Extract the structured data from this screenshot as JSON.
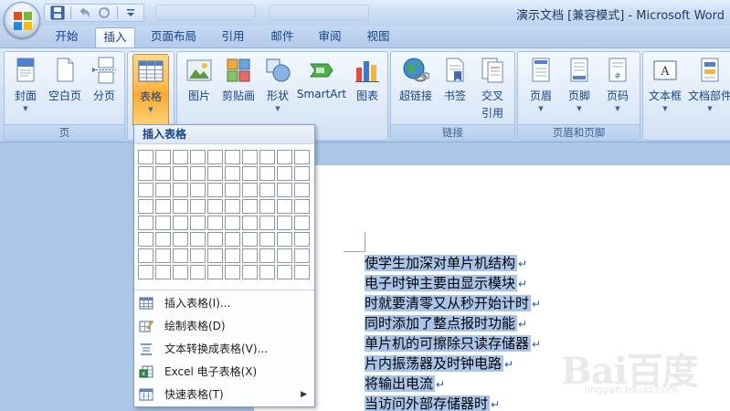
{
  "window": {
    "title": "演示文档 [兼容模式] - Microsoft Word"
  },
  "tabs": [
    {
      "label": "开始",
      "active": false
    },
    {
      "label": "插入",
      "active": true
    },
    {
      "label": "页面布局",
      "active": false
    },
    {
      "label": "引用",
      "active": false
    },
    {
      "label": "邮件",
      "active": false
    },
    {
      "label": "审阅",
      "active": false
    },
    {
      "label": "视图",
      "active": false
    }
  ],
  "ribbon": {
    "groups": {
      "pages": {
        "label": "页",
        "buttons": [
          "封面",
          "空白页",
          "分页"
        ]
      },
      "tables": {
        "buttons": [
          "表格"
        ]
      },
      "illustrations": {
        "buttons": [
          "图片",
          "剪贴画",
          "形状",
          "SmartArt",
          "图表"
        ]
      },
      "links": {
        "label": "链接",
        "buttons": [
          "超链接",
          "书签",
          "交叉",
          "引用"
        ]
      },
      "header_footer": {
        "label": "页眉和页脚",
        "buttons": [
          "页眉",
          "页脚",
          "页码"
        ]
      },
      "text": {
        "buttons": [
          "文本框",
          "文档部件"
        ]
      }
    }
  },
  "table_menu": {
    "header": "插入表格",
    "grid_cols": 10,
    "grid_rows": 8,
    "items": [
      {
        "label": "插入表格(I)...",
        "icon": "insert-table-icon"
      },
      {
        "label": "绘制表格(D)",
        "icon": "draw-table-icon"
      },
      {
        "label": "文本转换成表格(V)...",
        "icon": "text-to-table-icon"
      },
      {
        "label": "Excel 电子表格(X)",
        "icon": "excel-icon"
      },
      {
        "label": "快速表格(T)",
        "icon": "quick-table-icon",
        "submenu_arrow": "▶"
      }
    ]
  },
  "document": {
    "lines": [
      "使学生加深对单片机结构",
      "电子时钟主要由显示模块",
      "时就要清零又从秒开始计时",
      "同时添加了整点报时功能",
      "单片机的可擦除只读存储器",
      "片内振荡器及时钟电路",
      "将输出电流",
      "当访问外部存储器时"
    ],
    "paragraph_mark": "↵",
    "selection_color": "#a9c6ea"
  },
  "watermark": {
    "text": "Bai百度",
    "sub": "jingyan.baidu.com"
  }
}
